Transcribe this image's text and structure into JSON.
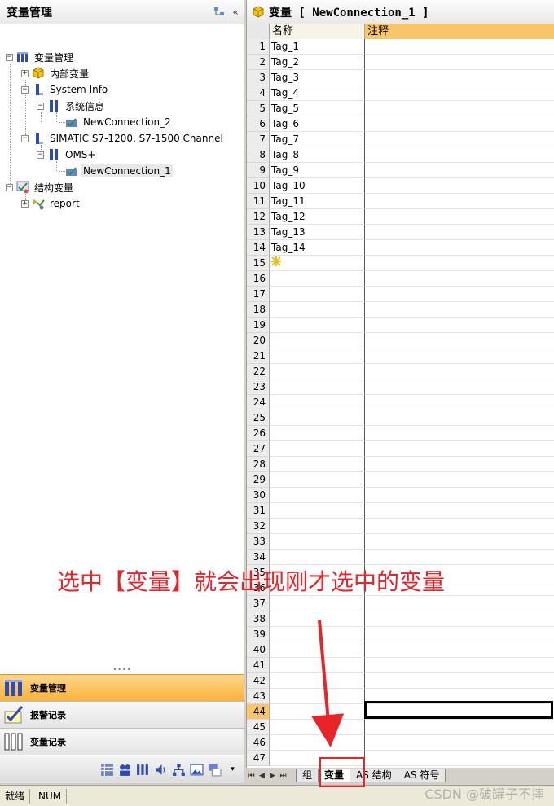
{
  "left_panel": {
    "title": "变量管理",
    "tree": [
      {
        "label": "变量管理",
        "icon": "tag-management-icon"
      },
      {
        "label": "内部变量",
        "icon": "cube-icon"
      },
      {
        "label": "System Info",
        "icon": "connection-icon"
      },
      {
        "label": "系统信息",
        "icon": "channel-icon"
      },
      {
        "label": "NewConnection_2",
        "icon": "connection-check-icon"
      },
      {
        "label": "SIMATIC S7-1200, S7-1500 Channel",
        "icon": "connection-icon"
      },
      {
        "label": "OMS+",
        "icon": "channel-icon"
      },
      {
        "label": "NewConnection_1",
        "icon": "connection-check-icon"
      },
      {
        "label": "结构变量",
        "icon": "structure-icon"
      },
      {
        "label": "report",
        "icon": "structure-icon"
      }
    ],
    "nav_buttons": [
      {
        "label": "变量管理"
      },
      {
        "label": "报警记录"
      },
      {
        "label": "变量记录"
      }
    ]
  },
  "right_panel": {
    "title": "变量 [ NewConnection_1 ]",
    "columns": [
      "名称",
      "注释"
    ],
    "rows": [
      "Tag_1",
      "Tag_2",
      "Tag_3",
      "Tag_4",
      "Tag_5",
      "Tag_6",
      "Tag_7",
      "Tag_8",
      "Tag_9",
      "Tag_10",
      "Tag_11",
      "Tag_12",
      "Tag_13",
      "Tag_14"
    ],
    "row_numbers": [
      "1",
      "2",
      "3",
      "4",
      "5",
      "6",
      "7",
      "8",
      "9",
      "10",
      "11",
      "12",
      "13",
      "14",
      "15",
      "16",
      "17",
      "18",
      "19",
      "20",
      "21",
      "22",
      "23",
      "24",
      "25",
      "26",
      "27",
      "28",
      "29",
      "30",
      "31",
      "32",
      "33",
      "34",
      "35",
      "36",
      "37",
      "38",
      "39",
      "40",
      "41",
      "42",
      "43",
      "44",
      "45",
      "46",
      "47"
    ],
    "highlighted_row": "44",
    "sheet_tabs": [
      "组",
      "变量",
      "AS 结构",
      "AS 符号"
    ],
    "active_tab": "变量"
  },
  "status_bar": {
    "ready": "就绪",
    "num": "NUM"
  },
  "annotation": {
    "text": "选中【变量】就会出现刚才选中的变量",
    "color": "#e8242a"
  },
  "watermark": "CSDN @破罐子不摔",
  "colors": {
    "active_nav": "#f9b23b",
    "highlight_row": "#f9c56b"
  }
}
